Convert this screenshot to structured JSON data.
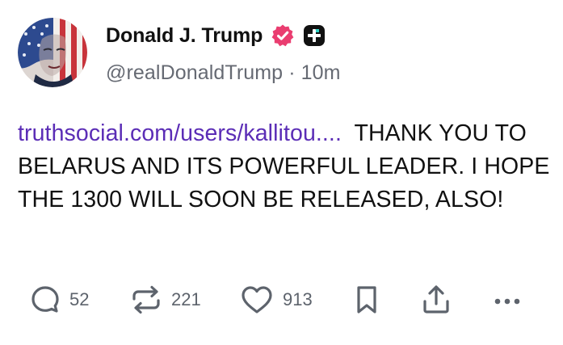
{
  "post": {
    "author": {
      "display_name": "Donald J. Trump",
      "handle": "@realDonaldTrump",
      "separator": "·",
      "time_ago": "10m",
      "verified_color": "#ea3d70",
      "avatar_icon": "flag-portrait-avatar"
    },
    "link_text": "truthsocial.com/users/kallitou....",
    "body_text": "  THANK YOU TO BELARUS AND ITS POWERFUL LEADER. I HOPE THE 1300 WILL SOON BE RELEASED, ALSO!",
    "link_color": "#5b2db6"
  },
  "actions": {
    "reply": {
      "icon": "reply-icon",
      "count": "52"
    },
    "retruth": {
      "icon": "retruth-icon",
      "count": "221"
    },
    "like": {
      "icon": "heart-icon",
      "count": "913"
    },
    "bookmark": {
      "icon": "bookmark-icon"
    },
    "share": {
      "icon": "share-icon"
    },
    "more": {
      "icon": "more-icon"
    }
  }
}
